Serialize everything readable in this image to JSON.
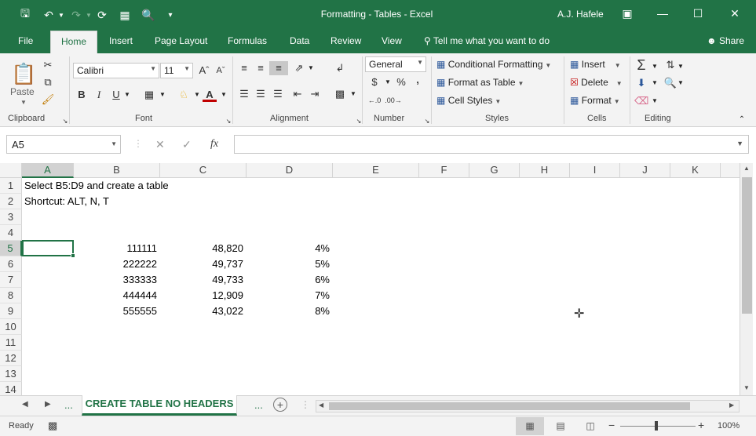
{
  "title_bar": {
    "title": "Formatting - Tables  -  Excel",
    "user": "A.J. Hafele",
    "icons": [
      "save-icon",
      "undo-icon",
      "redo-icon",
      "refresh-icon",
      "form-icon",
      "print-preview-icon",
      "customize-icon"
    ]
  },
  "tabs": {
    "items": [
      "File",
      "Home",
      "Insert",
      "Page Layout",
      "Formulas",
      "Data",
      "Review",
      "View"
    ],
    "tell_me": "Tell me what you want to do",
    "share": "Share"
  },
  "ribbon": {
    "clipboard": {
      "paste": "Paste",
      "label": "Clipboard"
    },
    "font": {
      "name": "Calibri",
      "size": "11",
      "bold": "B",
      "italic": "I",
      "underline": "U",
      "label": "Font"
    },
    "alignment": {
      "label": "Alignment"
    },
    "number": {
      "format": "General",
      "currency": "$",
      "percent": "%",
      "comma": ",",
      "label": "Number"
    },
    "styles": {
      "conditional": "Conditional Formatting",
      "table": "Format as Table",
      "cell_styles": "Cell Styles",
      "label": "Styles"
    },
    "cells": {
      "insert": "Insert",
      "delete": "Delete",
      "format": "Format",
      "label": "Cells"
    },
    "editing": {
      "label": "Editing"
    }
  },
  "formula_bar": {
    "name_box": "A5",
    "fx": "fx",
    "formula": ""
  },
  "grid": {
    "columns": [
      "A",
      "B",
      "C",
      "D",
      "E",
      "F",
      "G",
      "H",
      "I",
      "J",
      "K"
    ],
    "rows": [
      "1",
      "2",
      "3",
      "4",
      "5",
      "6",
      "7",
      "8",
      "9",
      "10",
      "11",
      "12",
      "13",
      "14"
    ],
    "a1": "Select B5:D9 and create a table",
    "a2": "Shortcut: ALT, N, T",
    "data": [
      [
        "111111",
        "48,820",
        "4%"
      ],
      [
        "222222",
        "49,737",
        "5%"
      ],
      [
        "333333",
        "49,733",
        "6%"
      ],
      [
        "444444",
        "12,909",
        "7%"
      ],
      [
        "555555",
        "43,022",
        "8%"
      ]
    ]
  },
  "sheets": {
    "active": "CREATE TABLE NO HEADERS",
    "more": "..."
  },
  "status": {
    "ready": "Ready",
    "zoom": "100%"
  },
  "colors": {
    "accent": "#217346",
    "ribbon_bg": "#f3f3f3"
  }
}
